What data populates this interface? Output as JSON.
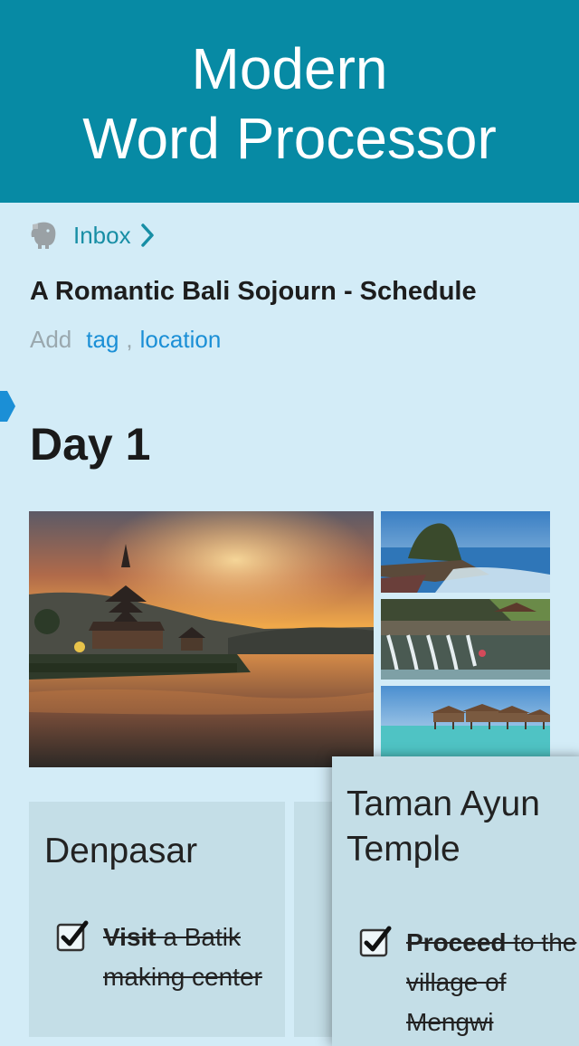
{
  "banner": {
    "line1": "Modern",
    "line2": "Word Processor"
  },
  "breadcrumb": {
    "icon": "evernote-elephant-icon",
    "label": "Inbox",
    "chevron": "chevron-right-icon"
  },
  "note": {
    "title": "A Romantic Bali Sojourn - Schedule",
    "meta": {
      "add_label": "Add",
      "tag_link": "tag",
      "separator": ",",
      "location_link": "location"
    },
    "heading": "Day 1"
  },
  "photos": [
    {
      "name": "lake-temple-sunset-photo"
    },
    {
      "name": "sea-temple-photo"
    },
    {
      "name": "water-temple-fountains-photo"
    },
    {
      "name": "overwater-bungalows-photo"
    }
  ],
  "cards": [
    {
      "title": "Denpasar",
      "todo": {
        "checked": true,
        "bold": "Visit",
        "rest": " a Batik making center"
      }
    },
    {
      "title": "Taman Ayun Temple",
      "todo": {
        "checked": true,
        "bold": "Proceed",
        "rest": " to the village of Mengwi"
      }
    }
  ],
  "colors": {
    "banner": "#078aa4",
    "background": "#d3ecf7",
    "link": "#1b8fd6",
    "accent": "#178ea5",
    "card": "#c4dee7"
  }
}
